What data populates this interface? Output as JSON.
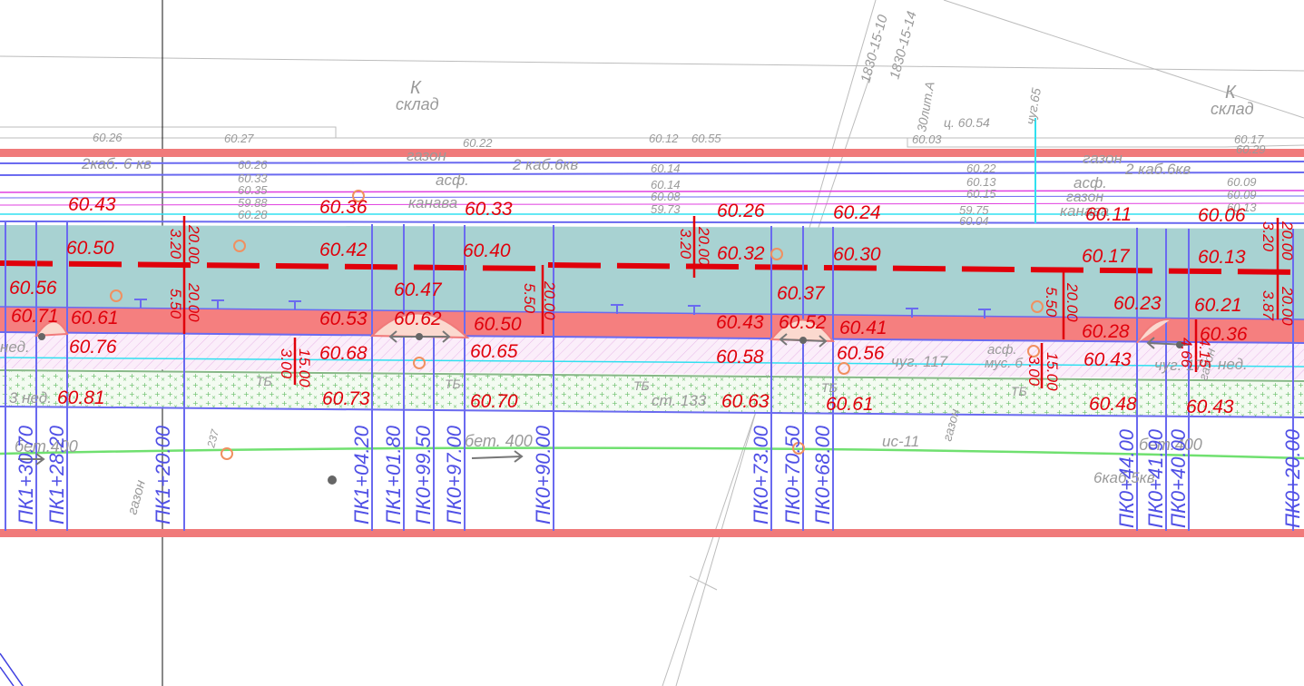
{
  "colors": {
    "border_red": "#f07a7a",
    "road_teal": "#a8d2d2",
    "sidewalk_red": "#f57f7f",
    "pink_hatch": "#f2d6ee",
    "green_dots": "#6cc06c",
    "blue_lines": "#6a6af0",
    "pink_lines": "#e040e0",
    "cyan": "#30e0f0",
    "green_line": "#70e070",
    "label_red": "#e0000b",
    "grey": "#9a9a9a"
  },
  "map": {
    "labels": {
      "k_left": "К",
      "sklad_left": "склад",
      "k_right": "К",
      "sklad_right": "склад",
      "gazon_top": "газон",
      "gazon_top_right": "газон",
      "kab_left": "2каб. 6 кв",
      "kab_mid": "2 каб.6кв",
      "kab_right": "2 каб.6кв",
      "asf_mid": "асф.",
      "asf_right": "асф.",
      "kanava_mid": "канава",
      "kanava_right": "канава",
      "gazon_right2": "газон",
      "parcel_1": "1830-15-10",
      "parcel_2": "1830-15-14",
      "lit": "30лит.А",
      "chug65": "чуг.65",
      "ts": "ц. 60.54",
      "bet400_left": "бет.400",
      "bet400_mid": "бет. 400",
      "bet400_right": "бет.400",
      "gazon_low": "газон",
      "gazon_low2": "газон",
      "gazon_low3": "газон",
      "st133": "ст. 133",
      "chug117": "чуг. 117",
      "asf_mus": "асф.",
      "mus": "мус. б",
      "ned_left": "нед.",
      "ned_right": "нед.",
      "ned_low": "3 нед.",
      "chug17": "чуг. 17",
      "ic11": "ис-11",
      "kab6": "6каб.5кв",
      "num237": "237",
      "tb1": "ТБ",
      "tb2": "ТБ",
      "tb3": "ТБ",
      "tb4": "ТБ",
      "tb5": "ТБ"
    },
    "grey_elevations": [
      "60.26",
      "60.27",
      "60.22",
      "60.12",
      "60.55",
      "60.03",
      "60.17",
      "60.29",
      "60.26",
      "60.33",
      "60.35",
      "59.88",
      "60.28",
      "60.14",
      "60.14",
      "60.08",
      "59.73",
      "60.22",
      "60.13",
      "60.15",
      "59.75",
      "60.04",
      "60.09",
      "60.09",
      "60.13"
    ],
    "elevations": [
      "60.43",
      "60.36",
      "60.33",
      "60.26",
      "60.24",
      "60.11",
      "60.06",
      "60.50",
      "60.42",
      "60.40",
      "60.32",
      "60.30",
      "60.17",
      "60.13",
      "60.56",
      "60.47",
      "60.37",
      "60.23",
      "60.21",
      "60.71",
      "60.61",
      "60.53",
      "60.62",
      "60.50",
      "60.43",
      "60.52",
      "60.41",
      "60.28",
      "60.36",
      "60.76",
      "60.68",
      "60.65",
      "60.58",
      "60.56",
      "60.43",
      "60.81",
      "60.73",
      "60.70",
      "60.63",
      "60.61",
      "60.48",
      "60.43"
    ],
    "dimensions": [
      "20.00",
      "3.20",
      "20.00",
      "5.50",
      "15.00",
      "3.00",
      "20.00",
      "5.50",
      "20.00",
      "3.20",
      "15.00",
      "3.00",
      "20.00",
      "5.50",
      "4.66",
      "4.15",
      "20.00",
      "3.20",
      "3.87",
      "20.00"
    ],
    "pickets": [
      "ПК1+30.70",
      "ПК1+28.20",
      "ПК1+20.00",
      "ПК1+04.20",
      "ПК1+01.80",
      "ПК0+99.50",
      "ПК0+97.00",
      "ПК0+90.00",
      "ПК0+73.00",
      "ПК0+70.50",
      "ПК0+68.00",
      "ПК0+44.00",
      "ПК0+41.90",
      "ПК0+40.00",
      "ПК0+20.00"
    ]
  }
}
